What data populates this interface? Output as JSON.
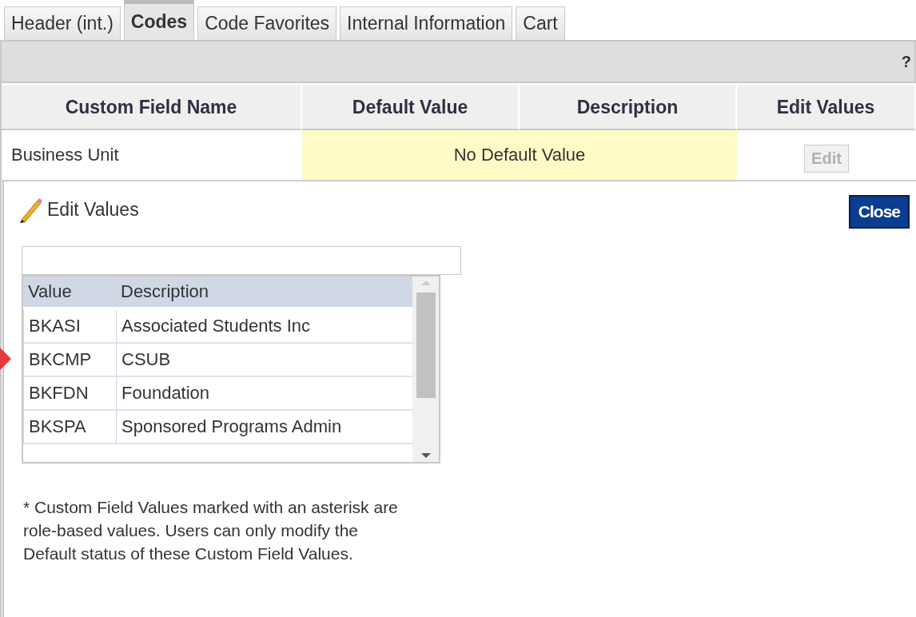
{
  "tabs": [
    {
      "label": "Header (int.)",
      "selected": false
    },
    {
      "label": "Codes",
      "selected": true
    },
    {
      "label": "Code Favorites",
      "selected": false
    },
    {
      "label": "Internal Information",
      "selected": false
    },
    {
      "label": "Cart",
      "selected": false
    }
  ],
  "toolbar": {
    "help": "?"
  },
  "table": {
    "columns": [
      "Custom Field Name",
      "Default Value",
      "Description",
      "Edit Values"
    ],
    "rows": [
      {
        "name": "Business Unit",
        "default_value": "No Default Value",
        "edit": {
          "label": "Edit",
          "disabled": true
        }
      }
    ]
  },
  "edit_panel": {
    "title": "Edit Values",
    "close": "Close",
    "list": {
      "columns": [
        "Value",
        "Description"
      ],
      "rows": [
        {
          "value": "BKASI",
          "description": "Associated Students Inc"
        },
        {
          "value": "BKCMP",
          "description": "CSUB"
        },
        {
          "value": "BKFDN",
          "description": "Foundation"
        },
        {
          "value": "BKSPA",
          "description": "Sponsored Programs Admin"
        }
      ]
    },
    "note": "* Custom Field Values marked with an asterisk are role-based values. Users can only modify the Default status of these Custom Field Values."
  }
}
